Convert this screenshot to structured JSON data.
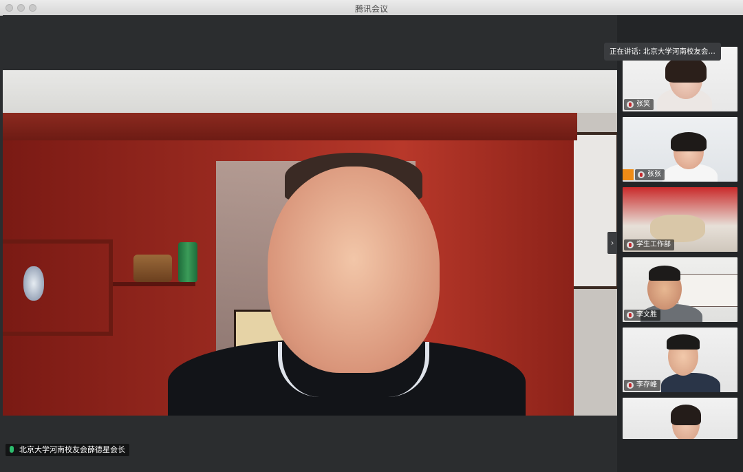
{
  "window": {
    "title": "腾讯会议"
  },
  "main_video": {
    "participant_name": "北京大学河南校友会薛德星会长",
    "mic_icon": "mic-on-icon",
    "mic_color": "#2dbd6e"
  },
  "speaking_indicator": {
    "text": "正在讲话: 北京大学河南校友会薛..."
  },
  "sidebar": {
    "collapse_icon": "chevron-right-icon",
    "collapse_glyph": "›",
    "participants": [
      {
        "name": "张笑",
        "mic_icon": "mic-muted-icon"
      },
      {
        "name": "张张",
        "mic_icon": "mic-muted-icon",
        "host_icon": "host-icon"
      },
      {
        "name": "学生工作部",
        "mic_icon": "mic-muted-icon"
      },
      {
        "name": "李文胜",
        "mic_icon": "mic-muted-icon"
      },
      {
        "name": "李存峰",
        "mic_icon": "mic-muted-icon"
      },
      {
        "name": "",
        "mic_icon": ""
      }
    ]
  }
}
